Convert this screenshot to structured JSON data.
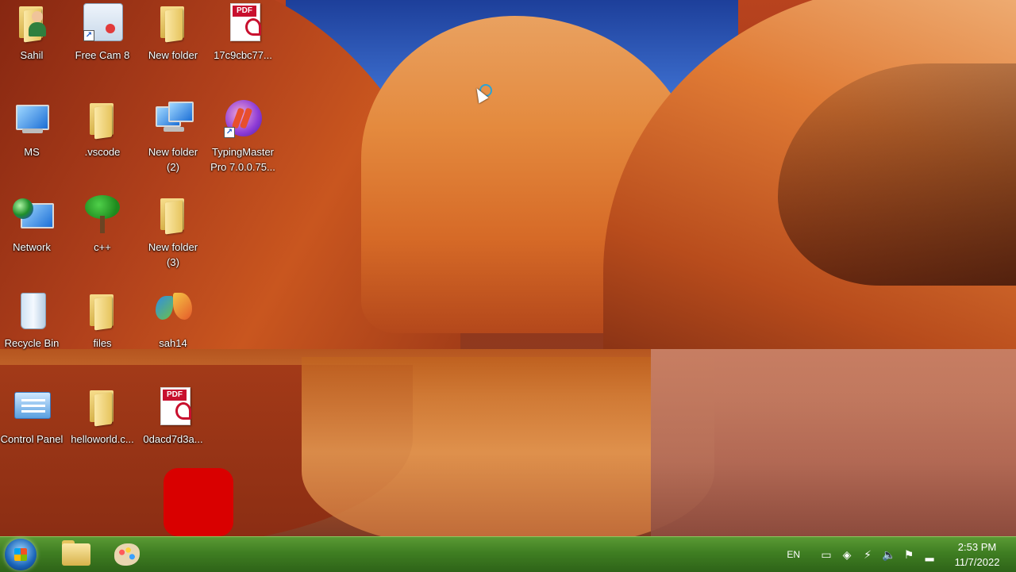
{
  "desktop": {
    "icons": [
      {
        "label": "Sahil",
        "icon": "user-folder-icon"
      },
      {
        "label": "Free Cam 8",
        "icon": "freecam-icon"
      },
      {
        "label": "New folder",
        "icon": "folder-icon"
      },
      {
        "label": "17c9cbc77...",
        "icon": "pdf-icon"
      },
      {
        "label": "MS",
        "icon": "computer-icon"
      },
      {
        "label": ".vscode",
        "icon": "folder-icon"
      },
      {
        "label": "New folder (2)",
        "icon": "network-computer-icon"
      },
      {
        "label": "TypingMaster Pro 7.0.0.75...",
        "icon": "typingmaster-icon"
      },
      {
        "label": "Network",
        "icon": "network-icon"
      },
      {
        "label": "c++",
        "icon": "tree-icon"
      },
      {
        "label": "New folder (3)",
        "icon": "folder-icon"
      },
      {
        "label": "Recycle Bin",
        "icon": "recycle-bin-icon"
      },
      {
        "label": "files",
        "icon": "folder-icon"
      },
      {
        "label": "sah14",
        "icon": "butterfly-icon"
      },
      {
        "label": "Control Panel",
        "icon": "control-panel-icon"
      },
      {
        "label": "helloworld.c...",
        "icon": "folder-icon"
      },
      {
        "label": "0dacd7d3a...",
        "icon": "pdf-icon"
      }
    ]
  },
  "taskbar": {
    "language": "EN",
    "time": "2:53 PM",
    "date": "11/7/2022",
    "pinned": [
      {
        "icon": "windows-explorer-icon"
      },
      {
        "icon": "paint-icon"
      }
    ]
  },
  "pdf_tag": "PDF",
  "colors": {
    "taskbar": "#3f7e22",
    "red_marker": "#d90000"
  }
}
